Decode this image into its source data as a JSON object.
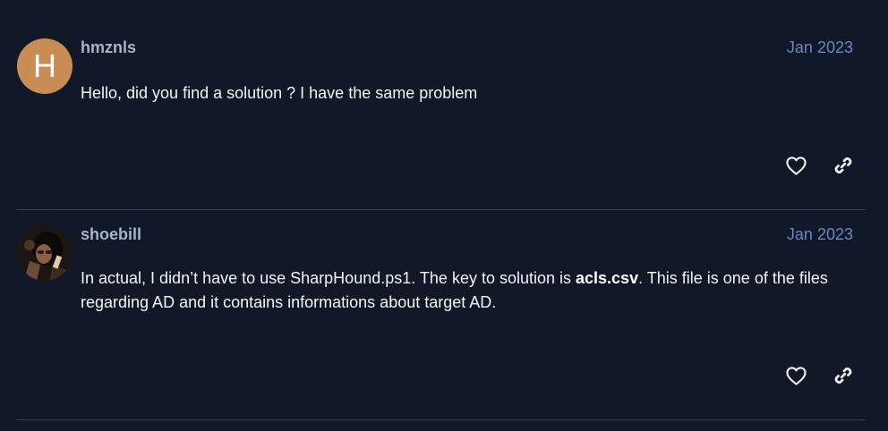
{
  "posts": [
    {
      "username": "hmznls",
      "date": "Jan 2023",
      "avatar_letter": "H",
      "avatar_color": "#c78d55",
      "text": "Hello, did you find a solution ? I have the same problem"
    },
    {
      "username": "shoebill",
      "date": "Jan 2023",
      "avatar_letter": "",
      "text_before": "In actual, I didn’t have to use SharpHound.ps1. The key to solution is ",
      "text_bold": "acls.csv",
      "text_after": ". This file is one of the files regarding AD and it contains informations about target AD."
    }
  ],
  "actions": {
    "like_icon": "heart-icon",
    "link_icon": "link-icon"
  },
  "colors": {
    "background": "#111827",
    "username": "#a7b4ce",
    "date": "#6b86c0",
    "divider": "#374151"
  }
}
